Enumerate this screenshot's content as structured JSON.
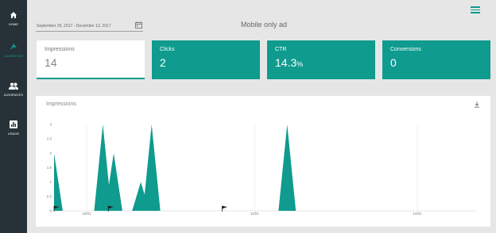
{
  "nav": {
    "items": [
      {
        "label": "HOME",
        "icon": "home-icon"
      },
      {
        "label": "CAMPAIGNS",
        "icon": "campaign-icon",
        "active": true
      },
      {
        "label": "AUDIENCES",
        "icon": "audience-icon"
      },
      {
        "label": "USAGE",
        "icon": "usage-icon"
      }
    ]
  },
  "header": {
    "date_range": "September 25, 2017 - December 12, 2017",
    "title": "Mobile only ad"
  },
  "kpis": [
    {
      "label": "Impressions",
      "value": "14",
      "selected": true
    },
    {
      "label": "Clicks",
      "value": "2"
    },
    {
      "label": "CTR",
      "value": "14.3",
      "suffix": "%"
    },
    {
      "label": "Conversions",
      "value": "0"
    }
  ],
  "chart_card": {
    "title": "Impressions"
  },
  "colors": {
    "accent": "#0f9b8e",
    "sidebar": "#263238",
    "background": "#e6e6e6"
  },
  "chart_data": {
    "type": "area",
    "title": "Impressions",
    "y_ticks": [
      "0",
      "0.5",
      "1",
      "1.5",
      "2",
      "2.5",
      "3"
    ],
    "ylim": [
      0,
      3
    ],
    "x_ticks": [
      {
        "date": "2017-10-01",
        "label": "10/01"
      },
      {
        "date": "2017-11-01",
        "label": "11/01"
      },
      {
        "date": "2017-12-01",
        "label": "12/01"
      }
    ],
    "xlim": [
      "2017-09-25",
      "2017-12-12"
    ],
    "series": [
      {
        "points": [
          {
            "date": "2017-09-25",
            "value": 2
          },
          {
            "date": "2017-10-04",
            "value": 3
          },
          {
            "date": "2017-10-06",
            "value": 2
          },
          {
            "date": "2017-10-11",
            "value": 1
          },
          {
            "date": "2017-10-13",
            "value": 3
          },
          {
            "date": "2017-11-07",
            "value": 3
          }
        ]
      }
    ],
    "flags": [
      "2017-09-25",
      "2017-10-05",
      "2017-10-26"
    ],
    "grid": "vertical"
  }
}
